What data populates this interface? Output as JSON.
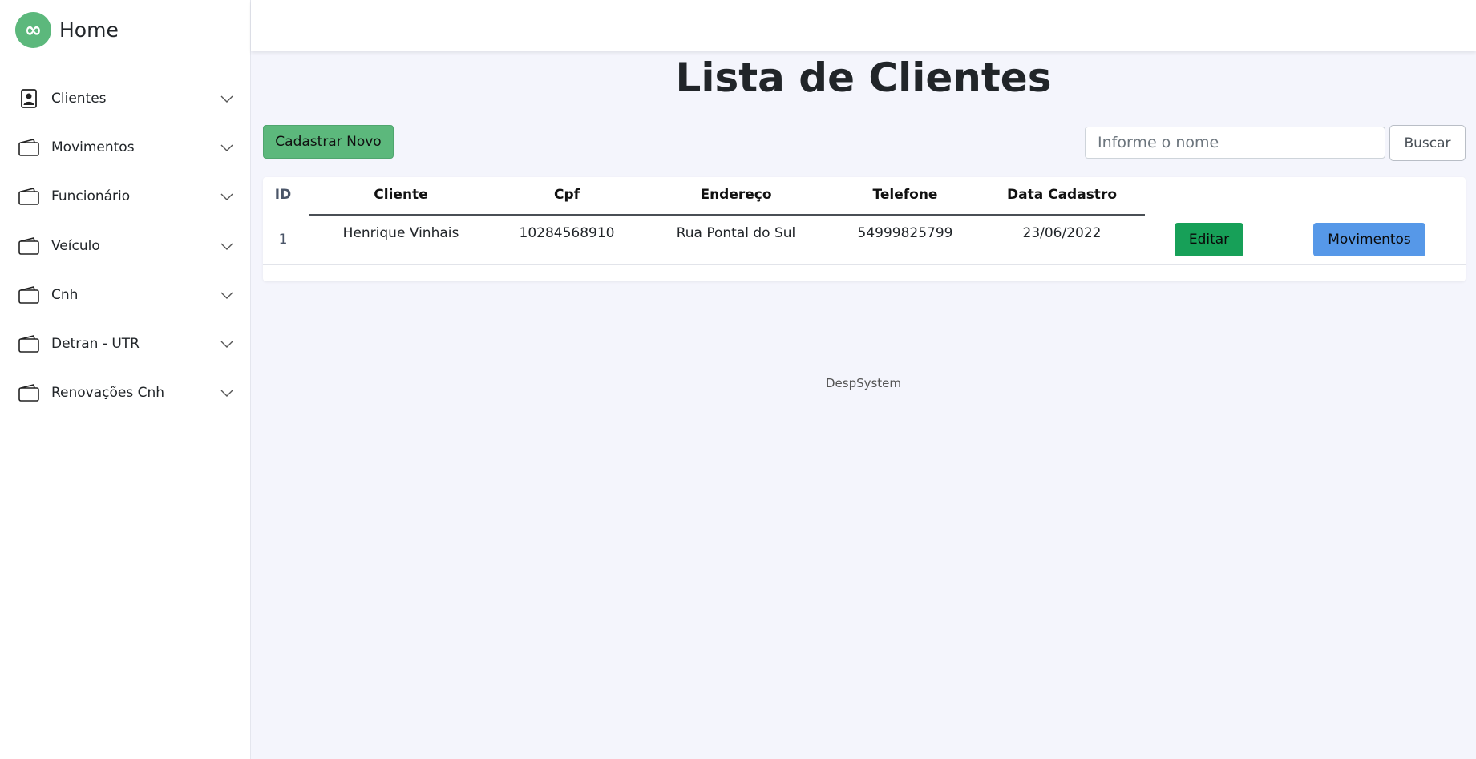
{
  "brand": {
    "logo_glyph": "∞",
    "title": "Home"
  },
  "sidebar": {
    "items": [
      {
        "label": "Clientes",
        "icon": "person-badge-icon"
      },
      {
        "label": "Movimentos",
        "icon": "wallet-icon"
      },
      {
        "label": "Funcionário",
        "icon": "wallet-icon"
      },
      {
        "label": "Veículo",
        "icon": "wallet-icon"
      },
      {
        "label": "Cnh",
        "icon": "wallet-icon"
      },
      {
        "label": "Detran - UTR",
        "icon": "wallet-icon"
      },
      {
        "label": "Renovações Cnh",
        "icon": "wallet-icon"
      }
    ]
  },
  "main": {
    "title": "Lista de Clientes",
    "new_button": "Cadastrar Novo",
    "search": {
      "placeholder": "Informe o nome",
      "value": "",
      "button": "Buscar"
    },
    "table": {
      "columns": [
        "ID",
        "Cliente",
        "Cpf",
        "Endereço",
        "Telefone",
        "Data Cadastro"
      ],
      "rows": [
        {
          "id": "1",
          "cliente": "Henrique Vinhais",
          "cpf": "10284568910",
          "endereco": "Rua Pontal do Sul",
          "telefone": "54999825799",
          "data_cadastro": "23/06/2022",
          "edit_label": "Editar",
          "movimentos_label": "Movimentos"
        }
      ]
    },
    "footer": "DespSystem"
  },
  "colors": {
    "brand_green": "#5cb87c",
    "edit_green": "#17a058",
    "movimentos_blue": "#5698e8",
    "page_bg": "#f4f5fc"
  }
}
